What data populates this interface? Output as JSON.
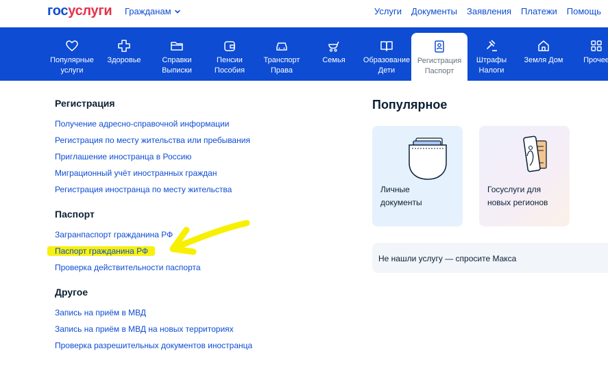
{
  "header": {
    "logo_part1": "гос",
    "logo_part2": "услуги",
    "audience_selector": "Гражданам",
    "nav": [
      "Услуги",
      "Документы",
      "Заявления",
      "Платежи",
      "Помощь"
    ]
  },
  "categories": [
    {
      "label": "Популярные\nуслуги",
      "icon": "heart-icon"
    },
    {
      "label": "Здоровье",
      "icon": "medical-cross-icon"
    },
    {
      "label": "Справки\nВыписки",
      "icon": "folder-icon"
    },
    {
      "label": "Пенсии\nПособия",
      "icon": "wallet-icon"
    },
    {
      "label": "Транспорт\nПрава",
      "icon": "car-icon"
    },
    {
      "label": "Семья",
      "icon": "stroller-icon"
    },
    {
      "label": "Образование\nДети",
      "icon": "open-book-icon"
    },
    {
      "label": "Регистрация\nПаспорт",
      "icon": "passport-icon",
      "active": true
    },
    {
      "label": "Штрафы\nНалоги",
      "icon": "gavel-icon"
    },
    {
      "label": "Земля Дом",
      "icon": "house-icon"
    },
    {
      "label": "Прочее",
      "icon": "grid-icon"
    }
  ],
  "sections": [
    {
      "title": "Регистрация",
      "links": [
        "Получение адресно-справочной информации",
        "Регистрация по месту жительства или пребывания",
        "Приглашение иностранца в Россию",
        "Миграционный учёт иностранных граждан",
        "Регистрация иностранца по месту жительства"
      ]
    },
    {
      "title": "Паспорт",
      "links": [
        "Загранпаспорт гражданина РФ",
        "Паспорт гражданина РФ",
        "Проверка действительности паспорта"
      ]
    },
    {
      "title": "Другое",
      "links": [
        "Запись на приём в МВД",
        "Запись на приём в МВД на новых территориях",
        "Проверка разрешительных документов иностранца"
      ]
    }
  ],
  "popular": {
    "title": "Популярное",
    "cards": [
      {
        "label": "Личные\nдокументы",
        "icon": "documents-pocket-icon"
      },
      {
        "label": "Госуслуги для\nновых регионов",
        "icon": "passport-hand-icon"
      }
    ],
    "ask": "Не нашли услугу — спросите Макса"
  },
  "colors": {
    "brand_blue": "#0d4cd3",
    "brand_red": "#e3324b",
    "text": "#0b1f33",
    "highlighter": "#f7f000"
  }
}
